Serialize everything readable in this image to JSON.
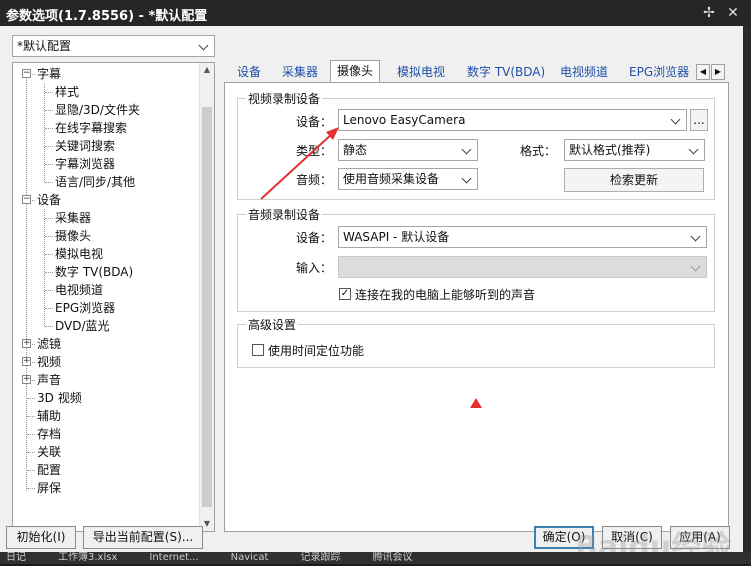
{
  "window": {
    "title": "参数选项(1.7.8556) - *默认配置",
    "pin_glyph": "✢",
    "close_glyph": "✕"
  },
  "profile_combo": {
    "value": "*默认配置"
  },
  "tree": {
    "items": [
      {
        "label": "字幕",
        "level": 0,
        "expander": "−"
      },
      {
        "label": "样式",
        "level": 1
      },
      {
        "label": "显隐/3D/文件夹",
        "level": 1
      },
      {
        "label": "在线字幕搜索",
        "level": 1
      },
      {
        "label": "关键词搜索",
        "level": 1
      },
      {
        "label": "字幕浏览器",
        "level": 1
      },
      {
        "label": "语言/同步/其他",
        "level": 1
      },
      {
        "label": "设备",
        "level": 0,
        "expander": "−"
      },
      {
        "label": "采集器",
        "level": 1
      },
      {
        "label": "摄像头",
        "level": 1
      },
      {
        "label": "模拟电视",
        "level": 1
      },
      {
        "label": "数字 TV(BDA)",
        "level": 1
      },
      {
        "label": "电视频道",
        "level": 1
      },
      {
        "label": "EPG浏览器",
        "level": 1
      },
      {
        "label": "DVD/蓝光",
        "level": 1
      },
      {
        "label": "滤镜",
        "level": 0,
        "expander": "+"
      },
      {
        "label": "视频",
        "level": 0,
        "expander": "+"
      },
      {
        "label": "声音",
        "level": 0,
        "expander": "+"
      },
      {
        "label": "3D 视频",
        "level": 0
      },
      {
        "label": "辅助",
        "level": 0
      },
      {
        "label": "存档",
        "level": 0
      },
      {
        "label": "关联",
        "level": 0
      },
      {
        "label": "配置",
        "level": 0
      },
      {
        "label": "屏保",
        "level": 0
      }
    ]
  },
  "tabs": [
    {
      "label": "设备",
      "active": false
    },
    {
      "label": "采集器",
      "active": false
    },
    {
      "label": "摄像头",
      "active": true
    },
    {
      "label": "模拟电视",
      "active": false
    },
    {
      "label": "数字 TV(BDA)",
      "active": false
    },
    {
      "label": "电视频道",
      "active": false
    },
    {
      "label": "EPG浏览器",
      "active": false
    }
  ],
  "tab_nav": {
    "left": "◀",
    "right": "▶"
  },
  "video_group": {
    "legend": "视频录制设备",
    "device_label": "设备：",
    "device_value": "Lenovo EasyCamera",
    "more_button": "...",
    "type_label": "类型：",
    "type_value": "静态",
    "format_label": "格式：",
    "format_value": "默认格式(推荐)",
    "audio_label": "音频：",
    "audio_value": "使用音频采集设备",
    "refresh_button": "检索更新"
  },
  "audio_group": {
    "legend": "音频录制设备",
    "device_label": "设备：",
    "device_value": "WASAPI - 默认设备",
    "input_label": "输入：",
    "input_value": "",
    "loopback_label": "连接在我的电脑上能够听到的声音",
    "loopback_checked": true
  },
  "advanced_group": {
    "legend": "高级设置",
    "timepos_label": "使用时间定位功能",
    "timepos_checked": false
  },
  "buttons": {
    "init": "初始化(I)",
    "export": "导出当前配置(S)...",
    "ok": "确定(O)",
    "cancel": "取消(C)",
    "apply": "应用(A)"
  },
  "annotation_color": "#e53030",
  "taskbar_items": [
    "日记",
    "工作簿3.xlsx",
    "Internet...",
    "Navicat",
    "记录跟踪",
    "腾讯会议"
  ],
  "watermark": "Baidu经验"
}
